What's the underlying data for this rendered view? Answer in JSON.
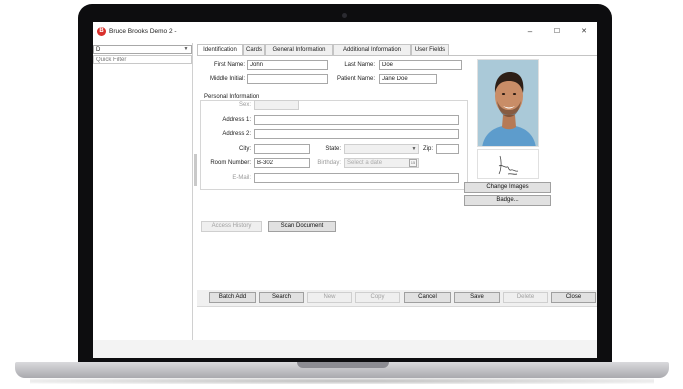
{
  "window": {
    "title": "Bruce Brooks Demo 2 -",
    "app_icon_glyph": "B",
    "minimize_glyph": "–",
    "maximize_glyph": "☐",
    "close_glyph": "✕"
  },
  "left_pane": {
    "selector_value": "D",
    "filter_placeholder": "Quick Filter"
  },
  "tabs": [
    {
      "label": "Identification",
      "active": true
    },
    {
      "label": "Cards",
      "active": false
    },
    {
      "label": "General Information",
      "active": false
    },
    {
      "label": "Additional Information",
      "active": false
    },
    {
      "label": "User Fields",
      "active": false
    }
  ],
  "identification": {
    "first_name_label": "First Name:",
    "first_name": "John",
    "last_name_label": "Last Name:",
    "last_name": "Doe",
    "middle_initial_label": "Middle Initial:",
    "middle_initial": "",
    "patient_name_label": "Patient Name:",
    "patient_name": "Jane Doe",
    "personal_info_title": "Personal Information",
    "sex_label": "Sex:",
    "address1_label": "Address 1:",
    "address2_label": "Address 2:",
    "city_label": "City:",
    "state_label": "State:",
    "zip_label": "Zip:",
    "room_number_label": "Room Number:",
    "room_number": "B-302",
    "birthday_label": "Birthday:",
    "birthday_placeholder": "Select a date",
    "calendar_glyph": "15",
    "email_label": "E-Mail:"
  },
  "buttons": {
    "change_images": "Change Images",
    "badge": "Badge...",
    "access_history": "Access History",
    "scan_document": "Scan Document",
    "batch_add": "Batch Add",
    "search": "Search",
    "new": "New",
    "copy": "Copy",
    "cancel": "Cancel",
    "save": "Save",
    "delete": "Delete",
    "close": "Close"
  },
  "colors": {
    "accent": "#d9302c",
    "photo_background": "#aac9d8",
    "shirt": "#5d9ccc",
    "skin": "#c98d67",
    "hair": "#2d1f17"
  }
}
